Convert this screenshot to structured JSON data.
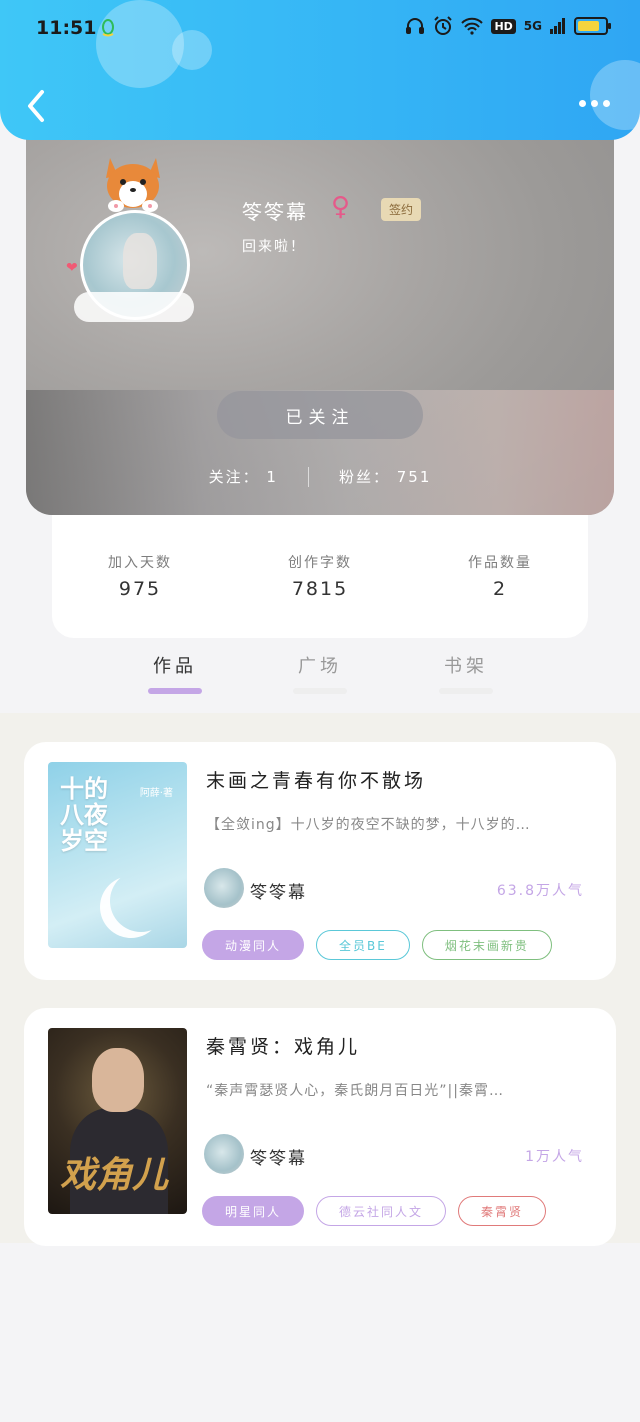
{
  "status_bar": {
    "time": "11:51",
    "hd": "HD",
    "signal": "5G"
  },
  "profile": {
    "username": "笭笭幕",
    "gender_symbol": "♀",
    "badge": "签约",
    "motto": "回来啦！",
    "follow_button": "已关注",
    "following_label": "关注：",
    "following_count": "1",
    "fans_label": "粉丝：",
    "fans_count": "751"
  },
  "stats": [
    {
      "label": "加入天数",
      "value": "975"
    },
    {
      "label": "创作字数",
      "value": "7815"
    },
    {
      "label": "作品数量",
      "value": "2"
    }
  ],
  "tabs": [
    {
      "label": "作品",
      "active": true
    },
    {
      "label": "广场",
      "active": false
    },
    {
      "label": "书架",
      "active": false
    }
  ],
  "works": [
    {
      "title": "末画之青春有你不散场",
      "description": "【全敛ing】十八岁的夜空不缺的梦，十八岁的…",
      "cover_title": "十的八夜岁空",
      "cover_author": "阿薛·著",
      "author": "笭笭幕",
      "popularity": "63.8万人气",
      "tags": [
        {
          "label": "动漫同人",
          "style": "filled",
          "color": "#c4a6e6"
        },
        {
          "label": "全员BE",
          "style": "outline",
          "color": "#5bc8d8"
        },
        {
          "label": "烟花末画新贵",
          "style": "outline",
          "color": "#7fbf7f"
        }
      ]
    },
    {
      "title": "秦霄贤：戏角儿",
      "description": "“秦声霄瑟贤人心，秦氏朗月百日光”||秦霄…",
      "cover_script": "戏角儿",
      "author": "笭笭幕",
      "popularity": "1万人气",
      "tags": [
        {
          "label": "明星同人",
          "style": "filled",
          "color": "#c4a6e6"
        },
        {
          "label": "德云社同人文",
          "style": "outline",
          "color": "#c4a6e6"
        },
        {
          "label": "秦霄贤",
          "style": "outline",
          "color": "#e07a7a"
        }
      ]
    }
  ]
}
